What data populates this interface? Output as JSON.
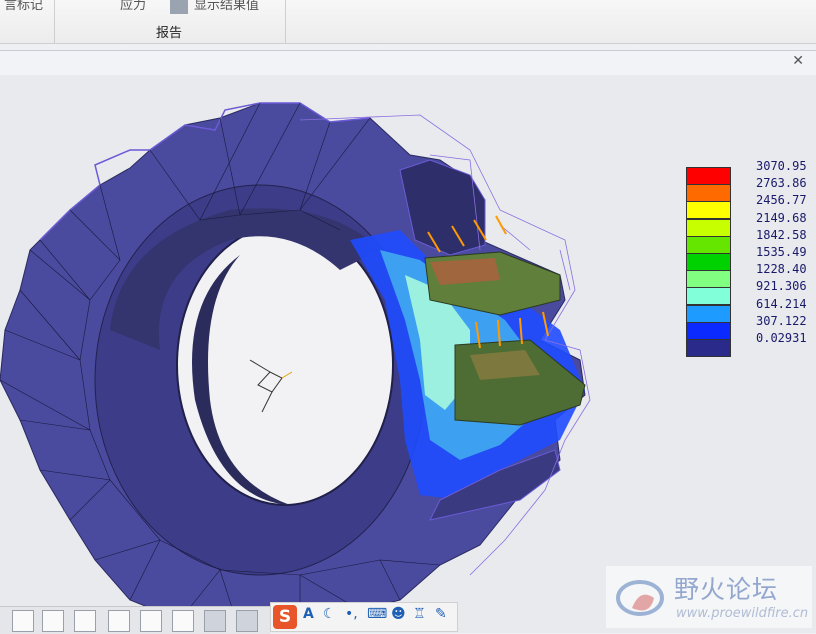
{
  "ribbon": {
    "left_partial": "言标记",
    "mid_partial": "应力",
    "right_partial": "显示结果值",
    "group_label": "报告"
  },
  "window": {
    "close_icon": "close-icon"
  },
  "legend": {
    "values": [
      "3070.95",
      "2763.86",
      "2456.77",
      "2149.68",
      "1842.58",
      "1535.49",
      "1228.40",
      "921.306",
      "614.214",
      "307.122",
      "0.02931"
    ],
    "colors": [
      "#ff0000",
      "#ff6a00",
      "#ffff00",
      "#c8ff00",
      "#64e600",
      "#00d200",
      "#80ff80",
      "#80ffd8",
      "#1e9bff",
      "#0a2aff",
      "#2a2a8a"
    ]
  },
  "toolbar": {
    "icons": [
      "zoom-fit-icon",
      "zoom-in-icon",
      "zoom-out-icon",
      "repaint-icon",
      "saved-views-icon",
      "orient-icon",
      "layers-icon",
      "csys-display-icon"
    ]
  },
  "ime": {
    "icons": [
      "sogou-s-icon",
      "font-icon",
      "moon-icon",
      "punct-icon",
      "keyboard-icon",
      "user-icon",
      "shirt-icon",
      "wrench-icon"
    ],
    "letter": "S",
    "font_letter": "A"
  },
  "watermark": {
    "title": "野火论坛",
    "url": "www.proewildfire.cn"
  }
}
